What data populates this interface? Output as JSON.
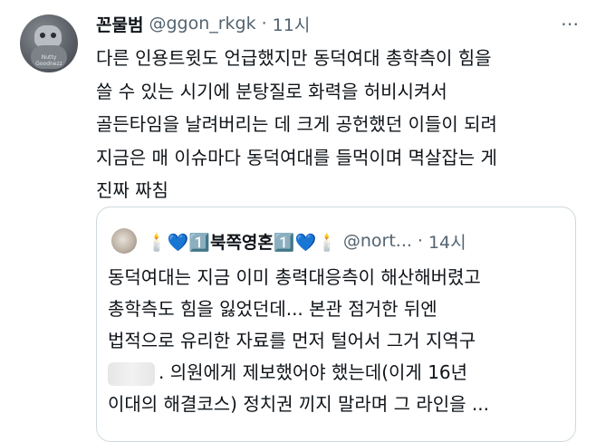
{
  "tweet": {
    "display_name": "꼰물범",
    "handle": "@ggon_rkgk",
    "separator": "·",
    "time": "11시",
    "more": "⋯",
    "avatar_caption": "Nutty Goodnezz",
    "lines": [
      "다른 인용트윗도 언급했지만 동덕여대 총학측이 힘을",
      "쓸 수 있는 시기에 분탕질로 화력을 허비시켜서",
      "골든타임을 날려버리는 데 크게 공헌했던 이들이 되려",
      "지금은 매 이슈마다 동덕여대를 들먹이며 멱살잡는 게",
      "진짜 짜침"
    ]
  },
  "quote": {
    "display_name": "🕯️💙1️⃣북쪽영혼1️⃣💙🕯️",
    "handle": "@nort...",
    "separator": "·",
    "time": "14시",
    "lines": [
      "동덕여대는 지금 이미 총력대응측이 해산해버렸고",
      "총학측도 힘을 잃었던데... 본관 점거한 뒤엔",
      "법적으로 유리한 자료를 먼저 털어서 그거 지역구",
      ". 의원에게 제보했어야 했는데(이게 16년",
      "이대의 해결코스) 정치권 끼지 말라며 그 라인을 ..."
    ]
  }
}
